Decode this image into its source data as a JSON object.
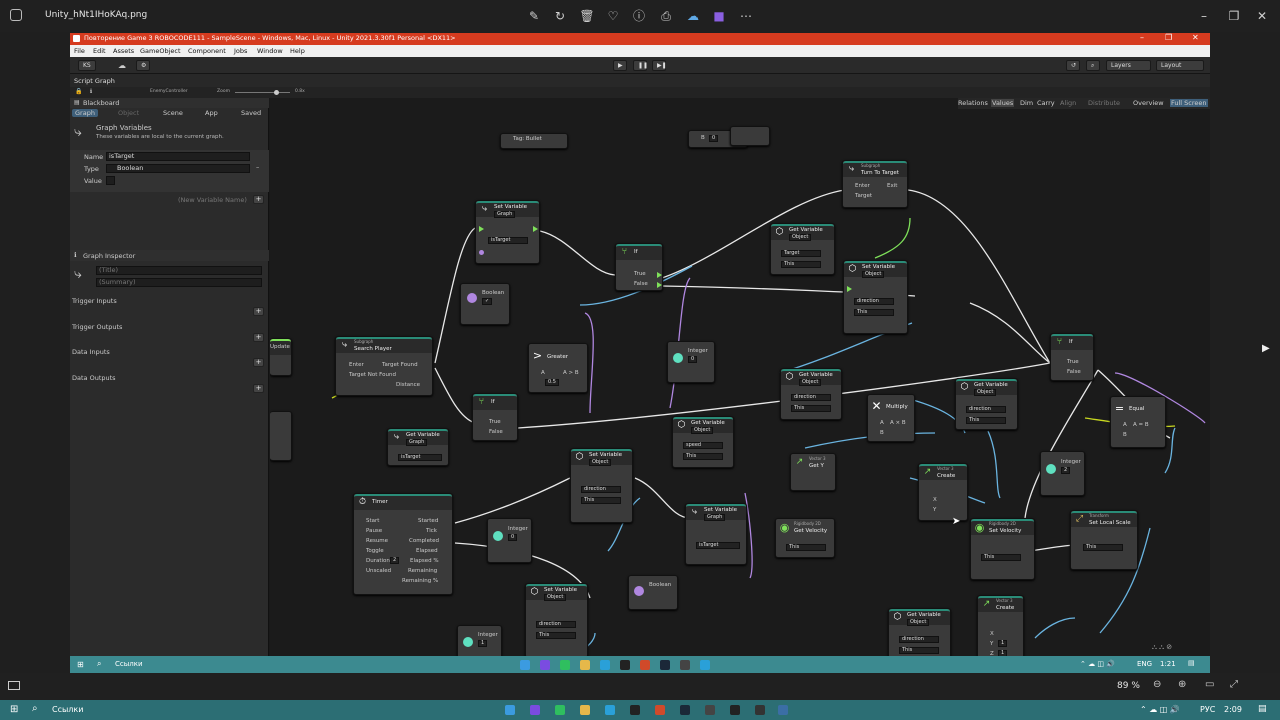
{
  "viewer": {
    "filename": "Unity_hNt1IHoKAq.png",
    "zoom": "89 %",
    "icons": [
      "edit-icon",
      "rotate-icon",
      "delete-icon",
      "favorite-icon",
      "info-icon",
      "print-icon",
      "cloud-icon",
      "clipchamp-icon",
      "more-icon"
    ]
  },
  "unity": {
    "title": "Повторение Game 3 ROBOCODE111 - SampleScene - Windows, Mac, Linux - Unity 2021.3.30f1 Personal <DX11>",
    "menu": [
      "File",
      "Edit",
      "Assets",
      "GameObject",
      "Component",
      "Jobs",
      "Window",
      "Help"
    ],
    "toolbar": {
      "account": "KS",
      "layers": "Layers",
      "layout": "Layout"
    },
    "script_graph_tab": "Script Graph",
    "breadcrumb": "EnemyController",
    "zoom_label": "Zoom",
    "zoom_value": "0.8x",
    "graph_toolbar": [
      "Relations",
      "Values",
      "Dim",
      "Carry",
      "Align",
      "Distribute",
      "Overview",
      "Full Screen"
    ]
  },
  "blackboard": {
    "title": "Blackboard",
    "tabs": [
      "Graph",
      "Object",
      "Scene",
      "App",
      "Saved"
    ],
    "section_title": "Graph Variables",
    "section_desc": "These variables are local to the current graph.",
    "var_name_label": "Name",
    "var_name": "isTarget",
    "var_type_label": "Type",
    "var_type": "Boolean",
    "var_value_label": "Value",
    "new_var_placeholder": "(New Variable Name)",
    "inspector_title": "Graph Inspector",
    "title_placeholder": "(Title)",
    "summary_placeholder": "(Summary)",
    "sections": [
      "Trigger Inputs",
      "Trigger Outputs",
      "Data Inputs",
      "Data Outputs"
    ]
  },
  "nodes": {
    "tag_bullet": {
      "title": "Tag: Bullet"
    },
    "b0": {
      "label": "B",
      "value": "0"
    },
    "set_var_1": {
      "sub": "Set Variable",
      "kind": "Graph",
      "var": "isTarget"
    },
    "boolean_1": {
      "title": "Boolean",
      "value": "✓"
    },
    "if_1": {
      "title": "If",
      "p1": "True",
      "p2": "False"
    },
    "subgraph_turn": {
      "sub": "Subgraph",
      "title": "Turn To Target",
      "p1": "Enter",
      "p2": "Exit",
      "p3": "Target"
    },
    "get_var_target": {
      "title": "Get Variable",
      "kind": "Object",
      "var": "Target",
      "obj": "This"
    },
    "set_var_dir1": {
      "title": "Set Variable",
      "kind": "Object",
      "var": "direction",
      "obj": "This"
    },
    "subgraph_search": {
      "sub": "Subgraph",
      "title": "Search Player",
      "p1": "Enter",
      "p2": "Target Found",
      "p3": "Target Not Found",
      "p4": "Distance"
    },
    "greater": {
      "title": "Greater",
      "p1": "A",
      "p2": "A > B",
      "p3": "B",
      "bval": "0.5"
    },
    "integer_0a": {
      "title": "Integer",
      "value": "0"
    },
    "if_2": {
      "title": "If",
      "p1": "True",
      "p2": "False"
    },
    "get_var_istarget": {
      "title": "Get Variable",
      "kind": "Graph",
      "var": "isTarget"
    },
    "get_var_dir": {
      "title": "Get Variable",
      "kind": "Object",
      "var": "direction",
      "obj": "This"
    },
    "multiply": {
      "title": "Multiply",
      "p1": "A",
      "p2": "A × B",
      "p3": "B"
    },
    "get_var_speed": {
      "title": "Get Variable",
      "kind": "Object",
      "var": "speed",
      "obj": "This"
    },
    "vec3_gety": {
      "sub": "Vector 3",
      "title": "Get Y"
    },
    "rb_getvel": {
      "sub": "Rigidbody 2D",
      "title": "Get Velocity",
      "obj": "This"
    },
    "vec3_create1": {
      "sub": "Vector 3",
      "title": "Create",
      "p1": "X",
      "p2": "Y"
    },
    "if_3": {
      "title": "If",
      "p1": "True",
      "p2": "False"
    },
    "get_var_dir2": {
      "title": "Get Variable",
      "kind": "Object",
      "var": "direction",
      "obj": "This"
    },
    "equal": {
      "title": "Equal",
      "p1": "A",
      "p2": "A = B",
      "p3": "B"
    },
    "integer_2": {
      "title": "Integer",
      "value": "2"
    },
    "rb_setvel": {
      "sub": "Rigidbody 2D",
      "title": "Set Velocity",
      "obj": "This"
    },
    "transform_scale": {
      "sub": "Transform",
      "title": "Set Local Scale",
      "obj": "This"
    },
    "timer": {
      "title": "Timer",
      "inputs": [
        "Start",
        "Pause",
        "Resume",
        "Toggle",
        "Duration",
        "Unscaled"
      ],
      "outputs": [
        "Started",
        "Tick",
        "Completed",
        "Elapsed",
        "Elapsed %",
        "Remaining",
        "Remaining %"
      ],
      "duration": "2"
    },
    "set_var_dir2": {
      "title": "Set Variable",
      "kind": "Object",
      "var": "direction",
      "obj": "This"
    },
    "integer_0b": {
      "title": "Integer",
      "value": "0"
    },
    "set_var_graph2": {
      "title": "Set Variable",
      "kind": "Graph",
      "var": "isTarget"
    },
    "boolean_2": {
      "title": "Boolean"
    },
    "set_var_dir3": {
      "title": "Set Variable",
      "kind": "Object",
      "var": "direction",
      "obj": "This"
    },
    "integer_1": {
      "title": "Integer",
      "value": "1"
    },
    "get_var_dir3": {
      "title": "Get Variable",
      "kind": "Object",
      "var": "direction",
      "obj": "This"
    },
    "vec3_create2": {
      "sub": "Vector 3",
      "title": "Create",
      "p1": "X",
      "p2": "Y",
      "p3": "Z",
      "yval": "1",
      "zval": "1"
    },
    "update": {
      "title": "Update"
    }
  },
  "taskbar": {
    "search_label": "Ссылки",
    "lang": "ENG",
    "time_inner": "1:21",
    "lang_outer": "РУС",
    "time_outer": "2:09"
  },
  "colors": {
    "accent_red": "#d63b1f",
    "flow_green": "#7fe15a",
    "taskbar_teal": "#3c8a90"
  }
}
